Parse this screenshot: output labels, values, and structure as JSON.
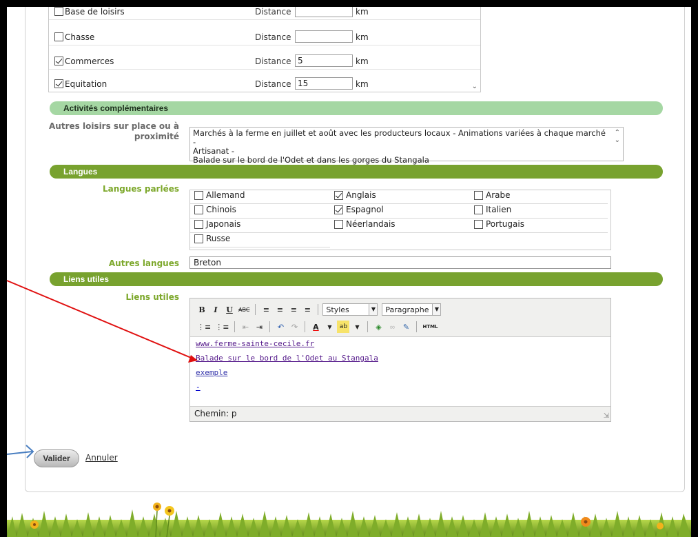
{
  "distances": {
    "label": "Distance",
    "unit": "km",
    "rows": [
      {
        "name": "Base de loisirs",
        "checked": false,
        "value": ""
      },
      {
        "name": "Chasse",
        "checked": false,
        "value": ""
      },
      {
        "name": "Commerces",
        "checked": true,
        "value": "5"
      },
      {
        "name": "Equitation",
        "checked": true,
        "value": "15"
      }
    ]
  },
  "sections": {
    "activites": "Activités complémentaires",
    "langues": "Langues",
    "liens": "Liens utiles"
  },
  "activites": {
    "label": "Autres loisirs sur place ou à proximité",
    "lines": [
      "Marchés à la ferme en juillet et août avec les producteurs locaux - Animations variées à chaque marché -",
      "Artisanat -",
      "Balade sur le bord de l'Odet et dans les gorges du Stangala"
    ]
  },
  "langues": {
    "label": "Langues parlées",
    "items": [
      {
        "name": "Allemand",
        "checked": false
      },
      {
        "name": "Anglais",
        "checked": true
      },
      {
        "name": "Arabe",
        "checked": false
      },
      {
        "name": "Chinois",
        "checked": false
      },
      {
        "name": "Espagnol",
        "checked": true
      },
      {
        "name": "Italien",
        "checked": false
      },
      {
        "name": "Japonais",
        "checked": false
      },
      {
        "name": "Néerlandais",
        "checked": false
      },
      {
        "name": "Portugais",
        "checked": false
      },
      {
        "name": "Russe",
        "checked": false
      }
    ],
    "autres_label": "Autres langues",
    "autres_value": "Breton"
  },
  "liens": {
    "label": "Liens utiles",
    "toolbar": {
      "styles": "Styles",
      "format": "Paragraphe",
      "html": "HTML"
    },
    "links": [
      "www.ferme-sainte-cecile.fr",
      "Balade sur le bord de l'Odet au Stangala",
      "exemple"
    ],
    "extra": "-",
    "path": "Chemin: p"
  },
  "actions": {
    "valider": "Valider",
    "annuler": "Annuler"
  },
  "colors": {
    "section_dark": "#78a22f",
    "section_light": "#a5d7a3",
    "label_green": "#7da82c",
    "annotation_red": "#e01010",
    "annotation_blue": "#4a7fc1"
  }
}
